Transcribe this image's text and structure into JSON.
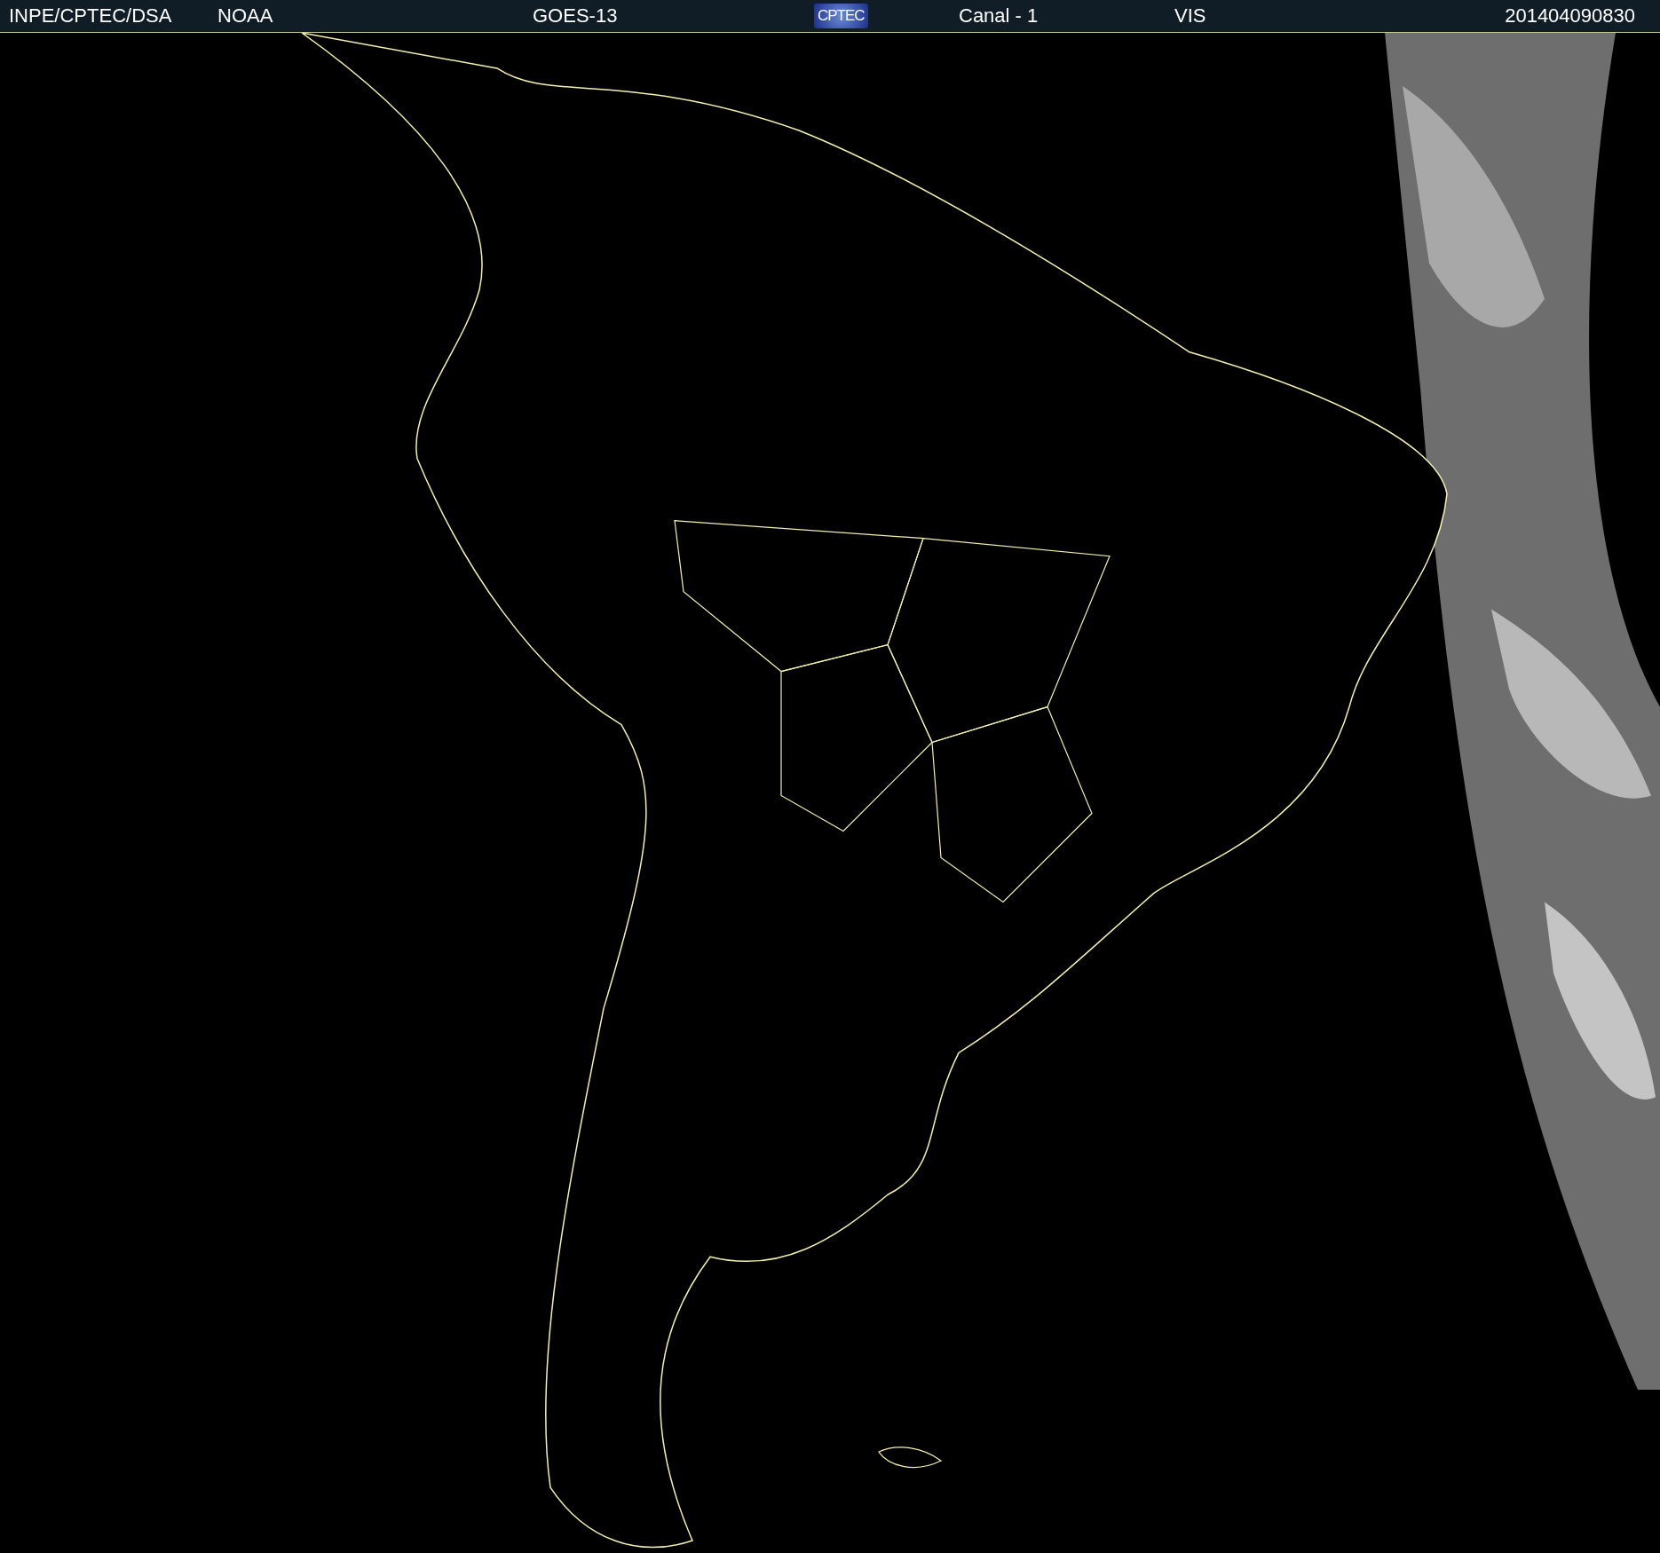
{
  "header": {
    "items": [
      {
        "kind": "text",
        "text": "INPE/CPTEC/DSA"
      },
      {
        "kind": "text",
        "text": "NOAA"
      },
      {
        "kind": "text",
        "text": "GOES-13"
      },
      {
        "kind": "logo",
        "text": "CPTEC"
      },
      {
        "kind": "text",
        "text": "Canal - 1"
      },
      {
        "kind": "text",
        "text": "VIS"
      },
      {
        "kind": "text",
        "text": "201404090830"
      }
    ]
  }
}
